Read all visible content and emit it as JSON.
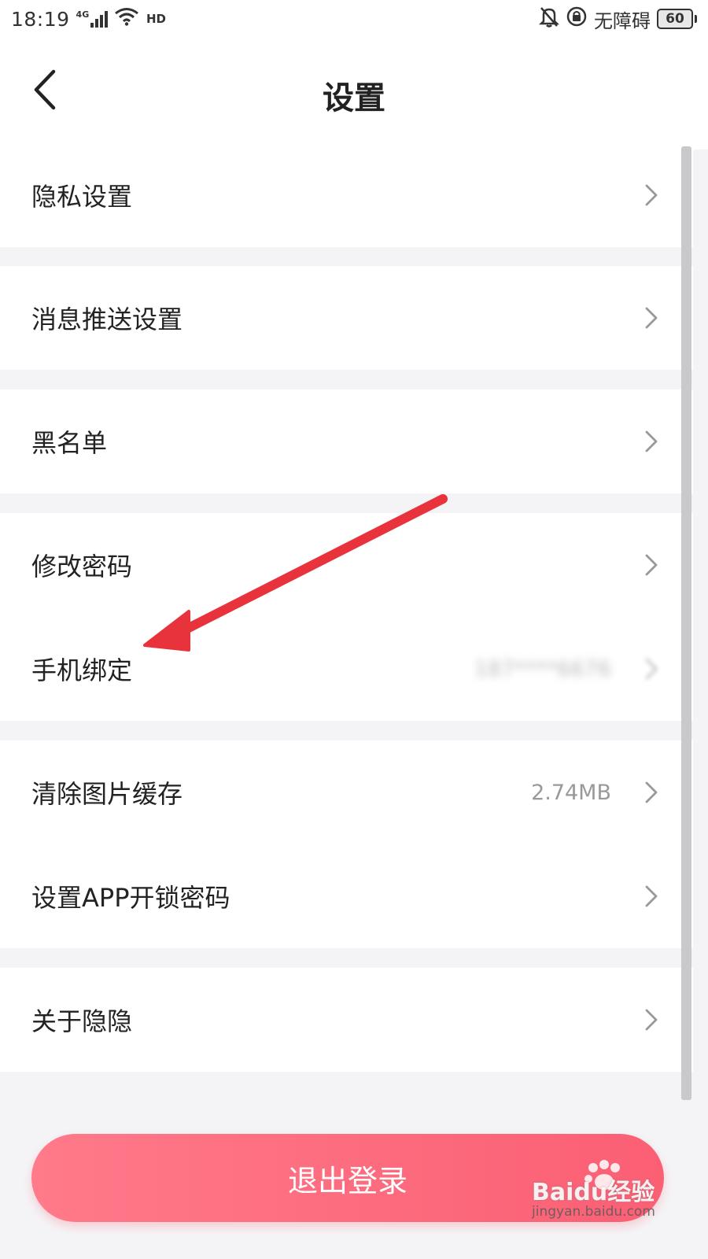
{
  "status_bar": {
    "time": "18:19",
    "network": "4G",
    "accessibility_label": "无障碍",
    "battery": "60",
    "icons": [
      "signal-icon",
      "wifi-icon",
      "hd-icon",
      "bell-muted-icon",
      "lock-rotation-icon",
      "battery-icon"
    ]
  },
  "header": {
    "title": "设置",
    "back_icon": "chevron-left-icon"
  },
  "groups": [
    {
      "items": [
        {
          "label": "隐私设置"
        }
      ]
    },
    {
      "items": [
        {
          "label": "消息推送设置"
        }
      ]
    },
    {
      "items": [
        {
          "label": "黑名单"
        }
      ]
    },
    {
      "items": [
        {
          "label": "修改密码"
        },
        {
          "label": "手机绑定",
          "value": "187****6676"
        }
      ]
    },
    {
      "items": [
        {
          "label": "清除图片缓存",
          "value": "2.74MB"
        },
        {
          "label": "设置APP开锁密码"
        }
      ]
    },
    {
      "items": [
        {
          "label": "关于隐隐"
        }
      ]
    }
  ],
  "logout": {
    "label": "退出登录"
  },
  "watermark": {
    "brand": "Baidu经验",
    "url": "jingyan.baidu.com"
  },
  "colors": {
    "accent": "#fb5f74",
    "annotation": "#e8333c",
    "background": "#f4f4f6"
  }
}
